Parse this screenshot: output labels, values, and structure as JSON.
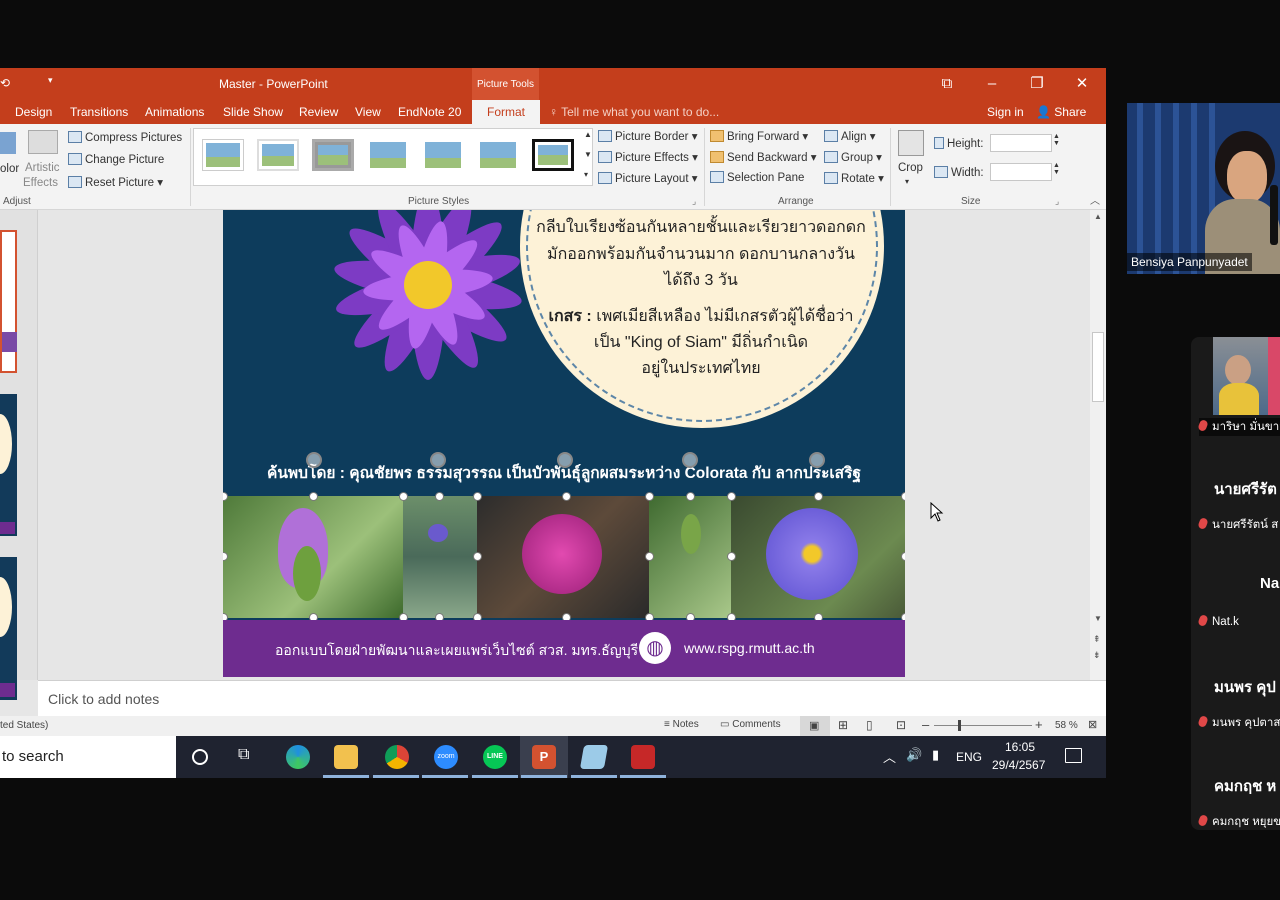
{
  "window": {
    "title": "Master - PowerPoint",
    "context_tab": "Picture Tools",
    "sign_in": "Sign in",
    "share": "Share",
    "tell_me": "Tell me what you want to do..."
  },
  "tabs": [
    "Design",
    "Transitions",
    "Animations",
    "Slide Show",
    "Review",
    "View",
    "EndNote 20",
    "Format"
  ],
  "ribbon": {
    "adjust": {
      "color": "olor",
      "artistic_effects_1": "Artistic",
      "artistic_effects_2": "Effects",
      "compress": "Compress Pictures",
      "change": "Change Picture",
      "reset": "Reset Picture",
      "label": "Adjust"
    },
    "picture_styles": {
      "border": "Picture Border",
      "effects": "Picture Effects",
      "layout": "Picture Layout",
      "label": "Picture Styles"
    },
    "arrange": {
      "bring_forward": "Bring Forward",
      "send_backward": "Send Backward",
      "selection_pane": "Selection Pane",
      "align": "Align",
      "group": "Group",
      "rotate": "Rotate",
      "label": "Arrange"
    },
    "size": {
      "crop": "Crop",
      "height": "Height:",
      "width": "Width:",
      "label": "Size"
    }
  },
  "slide": {
    "text_line1": "กลีบใบเรียงซ้อนกันหลายชั้นและเรียวยาวดอกดก",
    "text_line2": "มักออกพร้อมกันจำนวนมาก ดอกบานกลางวัน",
    "text_line3": "ได้ถึง 3 วัน",
    "text_label": "เกสร :",
    "text_line4": "เพศเมียสีเหลือง ไม่มีเกสรตัวผู้ได้ชื่อว่า",
    "text_line5": "เป็น \"King of Siam\" มีถิ่นกำเนิด",
    "text_line6": "อยู่ในประเทศไทย",
    "caption": "ค้นพบโดย : คุณชัยพร ธรรมสุวรรณ เป็นบัวพันธุ์ลูกผสมระหว่าง Colorata กับ ลากประเสริฐ",
    "footer_text": "ออกแบบโดยฝ่ายพัฒนาและเผยแพร่เว็บไซต์ สวส. มทร.ธัญบุรี",
    "footer_url": "www.rspg.rmutt.ac.th"
  },
  "notes": {
    "placeholder": "Click to add notes"
  },
  "status": {
    "language": "ted States)",
    "notes": "Notes",
    "comments": "Comments",
    "zoom": "58 %"
  },
  "taskbar": {
    "search": "to search",
    "language": "ENG",
    "time": "16:05",
    "date": "29/4/2567",
    "zoom_icon_text": "zoom",
    "line_icon_text": "LINE"
  },
  "participants": {
    "video_name": "Bensiya Panpunyadet",
    "list": [
      {
        "big": "",
        "label": "มาริษา มั่นขาว"
      },
      {
        "big": "นายศรีรัต",
        "label": "นายศรีรัตน์ ส"
      },
      {
        "big": "Na",
        "label": "Nat.k"
      },
      {
        "big": "มนพร คุป",
        "label": "มนพร คุปตาส"
      },
      {
        "big": "คมกฤช ห",
        "label": "คมกฤช หยุยข"
      }
    ]
  },
  "colors": {
    "ppt_accent": "#c43e1c",
    "slide_bg": "#0d3c5c",
    "footer_purple": "#6e2c8f",
    "circle_cream": "#fdf2d7"
  }
}
